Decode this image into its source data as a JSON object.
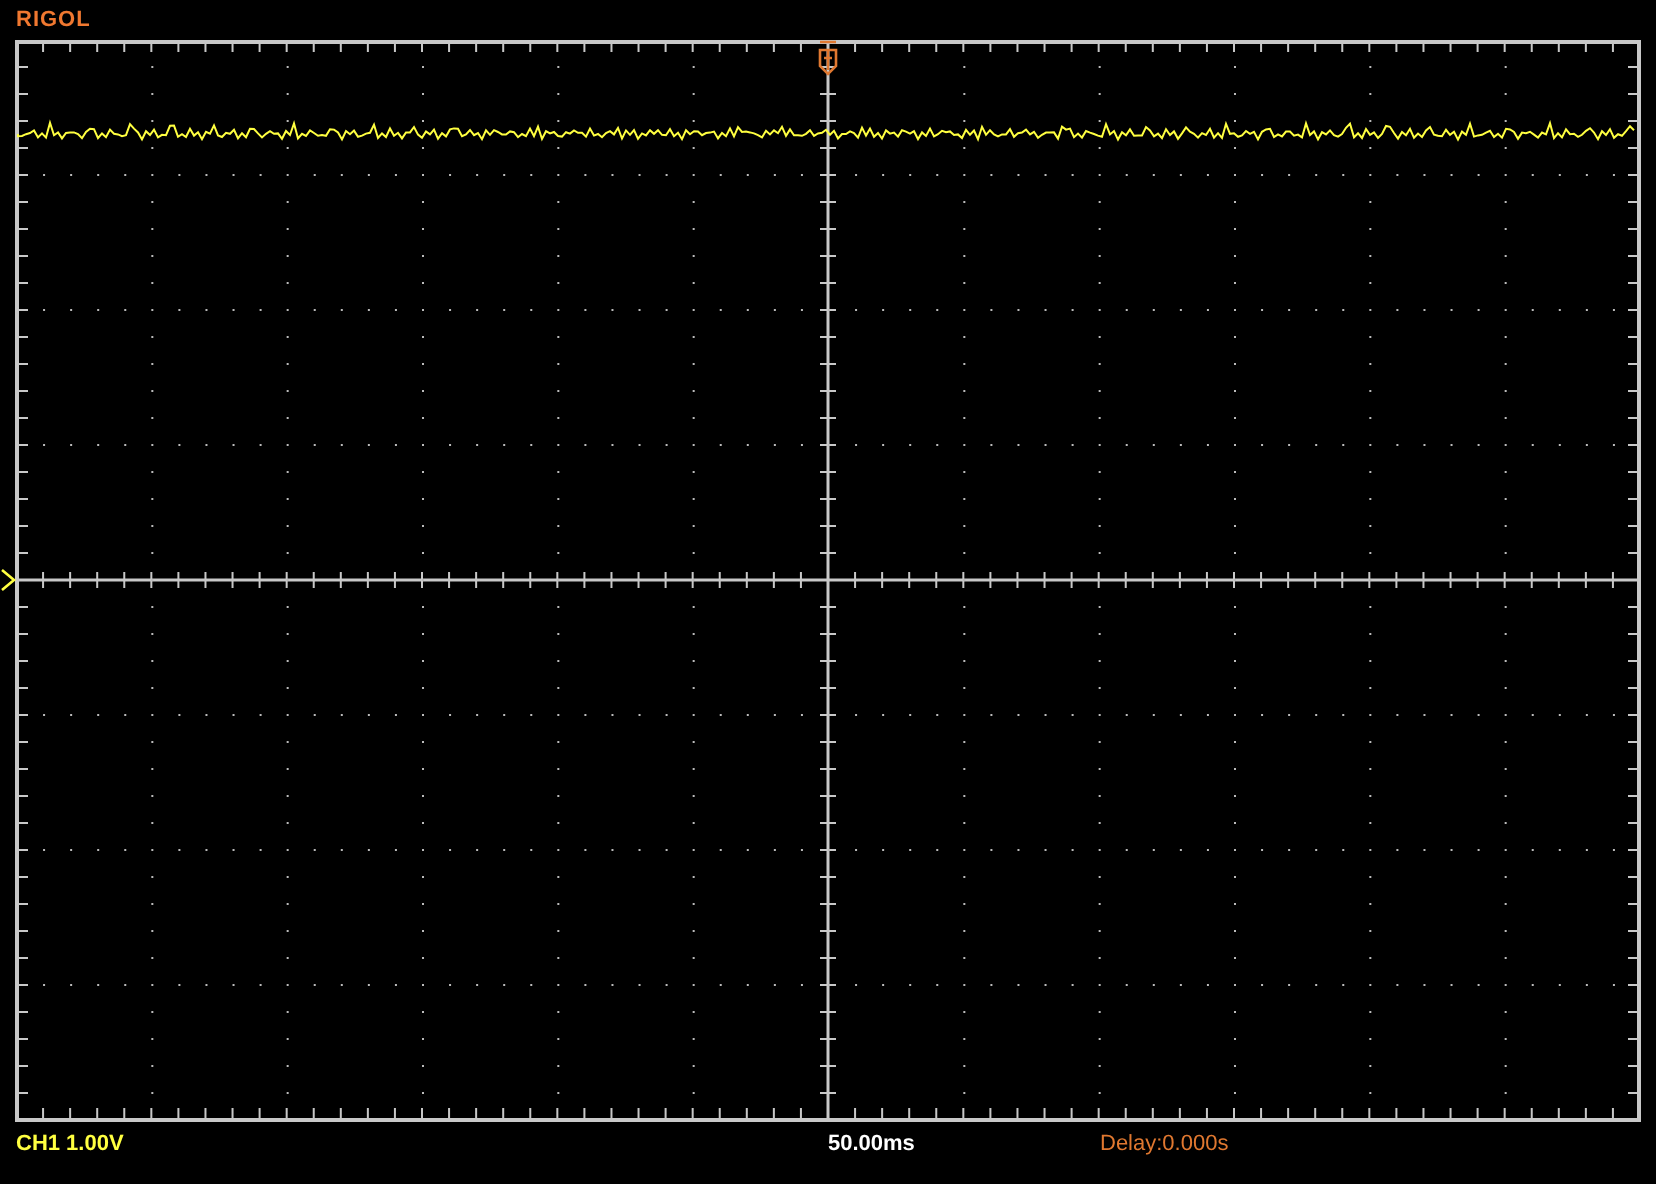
{
  "logo": "RIGOL",
  "status_bar": {
    "channel": "CH1 1.00V",
    "timebase": "50.00ms",
    "delay": "Delay:0.000s"
  }
}
